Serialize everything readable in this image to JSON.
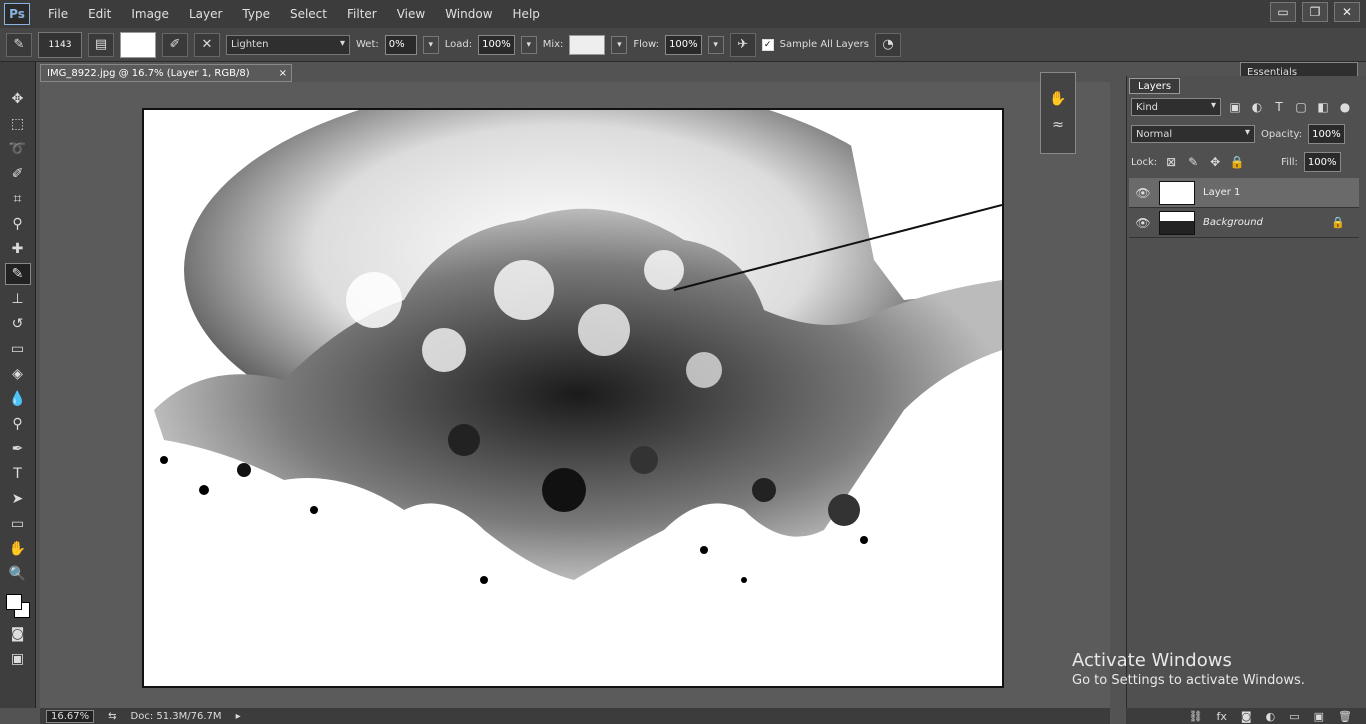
{
  "app": {
    "logo": "Ps"
  },
  "menu": [
    "File",
    "Edit",
    "Image",
    "Layer",
    "Type",
    "Select",
    "Filter",
    "View",
    "Window",
    "Help"
  ],
  "window_controls": {
    "minimize": "▭",
    "restore": "❐",
    "close": "✕"
  },
  "options_bar": {
    "brush_size": "1143",
    "mode": "Lighten",
    "wet_label": "Wet:",
    "wet_value": "0%",
    "load_label": "Load:",
    "load_value": "100%",
    "mix_label": "Mix:",
    "flow_label": "Flow:",
    "flow_value": "100%",
    "sample_all_layers": "Sample All Layers",
    "workspace": "Essentials"
  },
  "document": {
    "tab_title": "IMG_8922.jpg @ 16.7% (Layer 1, RGB/8)",
    "close": "×"
  },
  "layers_panel": {
    "tab": "Layers",
    "filter": "Kind",
    "blend_mode": "Normal",
    "opacity_label": "Opacity:",
    "opacity_value": "100%",
    "lock_label": "Lock:",
    "fill_label": "Fill:",
    "fill_value": "100%",
    "layers": [
      {
        "name": "Layer 1",
        "selected": true
      },
      {
        "name": "Background",
        "selected": false
      }
    ]
  },
  "status_bar": {
    "zoom": "16.67%",
    "doc_info": "Doc: 51.3M/76.7M"
  },
  "activation": {
    "line1": "Activate Windows",
    "line2": "Go to Settings to activate Windows."
  }
}
